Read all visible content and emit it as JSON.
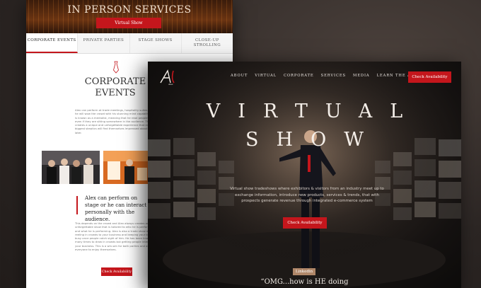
{
  "colors": {
    "accent": "#c4161c",
    "background": "#2a2523",
    "front_bg": "#141110",
    "badge": "#b08769"
  },
  "back": {
    "banner": {
      "title": "IN PERSON SERVICES",
      "button": "Virtual Show"
    },
    "tabs": [
      {
        "label": "CORPORATE EVENTS",
        "active": true
      },
      {
        "label": "PRIVATE PARTIES",
        "active": false
      },
      {
        "label": "STAGE SHOWS",
        "active": false
      },
      {
        "label": "CLOSE-UP STROLLING",
        "active": false
      }
    ],
    "icon": "tie-icon",
    "section_title": "CORPORATE EVENTS",
    "intro": "Alex can perform at trade meetings, hospitality suites, where he will wow the crowd with his stunning mind capabilities. Alex is known as a mentalist, meaning that he read peoples' minds, even if they are sitting somewhere in the audience. This creates a unique and unforgettable experience that even the biggest skeptics will find themselves impressed about years later.",
    "quote": "Alex can perform on stage or he can interact personally with the audience.",
    "body": "This depends on the crowd and Alex always creates an unforgettable show that is tailored to who he is performing for and what he is performing. Alex is also a trade show magnet, reeling in crowds to your business and keeping your booth busy once people catch sight of him. He has been known many times to draw in crowds but getting people interested in your business. This is a win-win for both parties and allows everyone to enjoy themselves.",
    "button": "Check Availability"
  },
  "front": {
    "logo_text": "Alex",
    "nav": [
      "ABOUT",
      "VIRTUAL",
      "CORPORATE",
      "SERVICES",
      "MEDIA",
      "LEARN THE ART"
    ],
    "nav_button": "Check Availability",
    "hero_line1": "VIRTUAL",
    "hero_line2": "SHOW",
    "description": "Virtual show tradeshows where exhibitors & visitors from an industry meet up to exchange information, introduce new products, services & trends, that with prospects generate revenue through integrated e-commerce system",
    "button": "Check Availability",
    "badge": "Linkedin",
    "testimonial": "“OMG...how is HE doing"
  }
}
